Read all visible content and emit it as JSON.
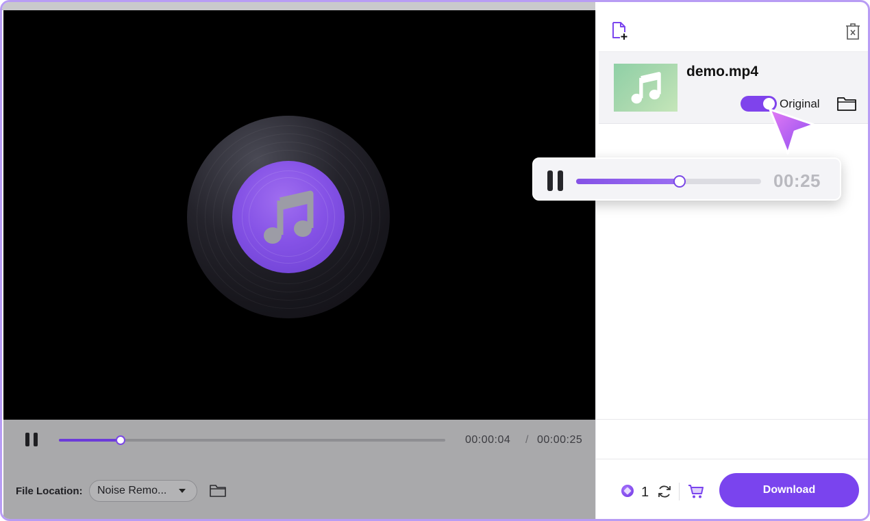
{
  "colors": {
    "accent": "#7a44ee",
    "progress": "#6c3bd9",
    "thumbnail": "#a9d8ae",
    "frame_border": "#b89cf4"
  },
  "player": {
    "current_time": "00:00:04",
    "separator": "/",
    "total_time": "00:00:25",
    "progress_fraction": 0.16,
    "icons": [
      "pause-icon"
    ]
  },
  "preview": {
    "icon": "music-note-icon"
  },
  "file_location": {
    "label": "File Location:",
    "selected": "Noise Remo...",
    "icons": [
      "chevron-down-icon",
      "folder-icon"
    ]
  },
  "panel": {
    "icons": [
      "add-file-icon",
      "trash-icon"
    ],
    "file": {
      "name": "demo.mp4",
      "toggle_label": "Original",
      "toggle_on": true,
      "icons": [
        "music-note-icon",
        "folder-icon"
      ]
    }
  },
  "mini_player": {
    "time": "00:25",
    "progress_fraction": 0.56,
    "icons": [
      "pause-icon"
    ]
  },
  "bottom_bar": {
    "credits": "1",
    "download_label": "Download",
    "icons": [
      "credit-icon",
      "refresh-icon",
      "cart-icon"
    ]
  }
}
